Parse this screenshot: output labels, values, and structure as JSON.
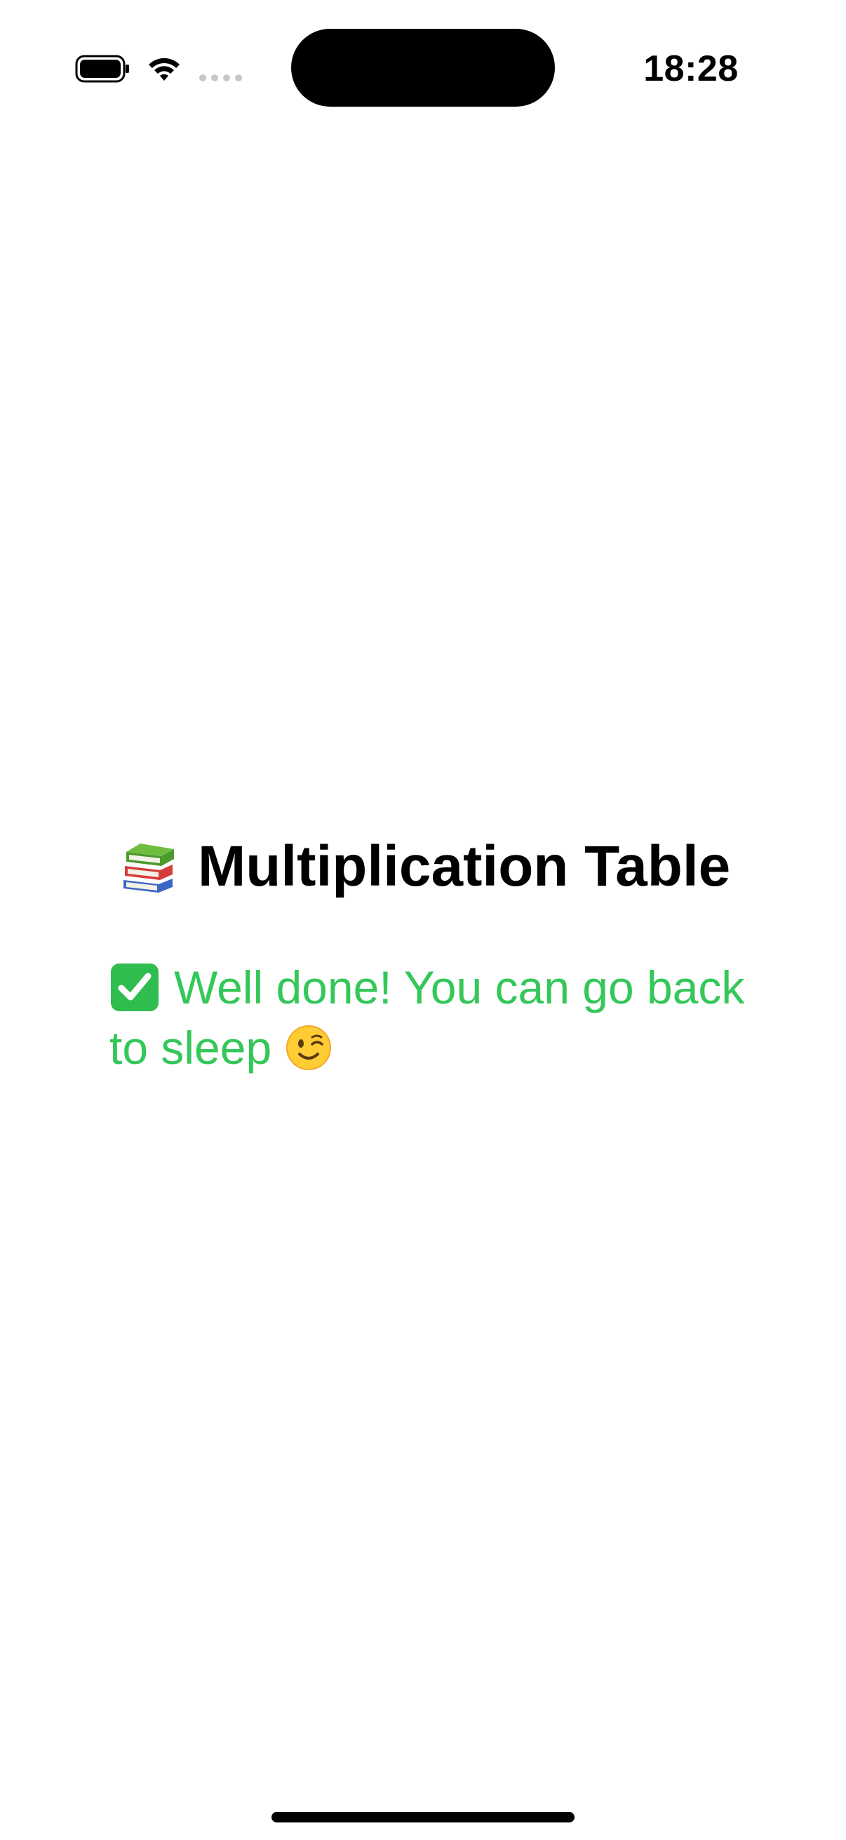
{
  "status_bar": {
    "time": "18:28",
    "icons": [
      "battery-icon",
      "wifi-icon",
      "cellular-signal-icon"
    ]
  },
  "main": {
    "title_icon": "books-icon",
    "title": "Multiplication Table",
    "message": {
      "leading_icon": "check-mark-icon",
      "line1": "Well done! You can go back",
      "line2": "to sleep",
      "trailing_icon": "winking-face-icon"
    }
  },
  "colors": {
    "success_text": "#34c759",
    "title_text": "#000000",
    "background": "#ffffff",
    "check_green": "#2ebd4e"
  }
}
